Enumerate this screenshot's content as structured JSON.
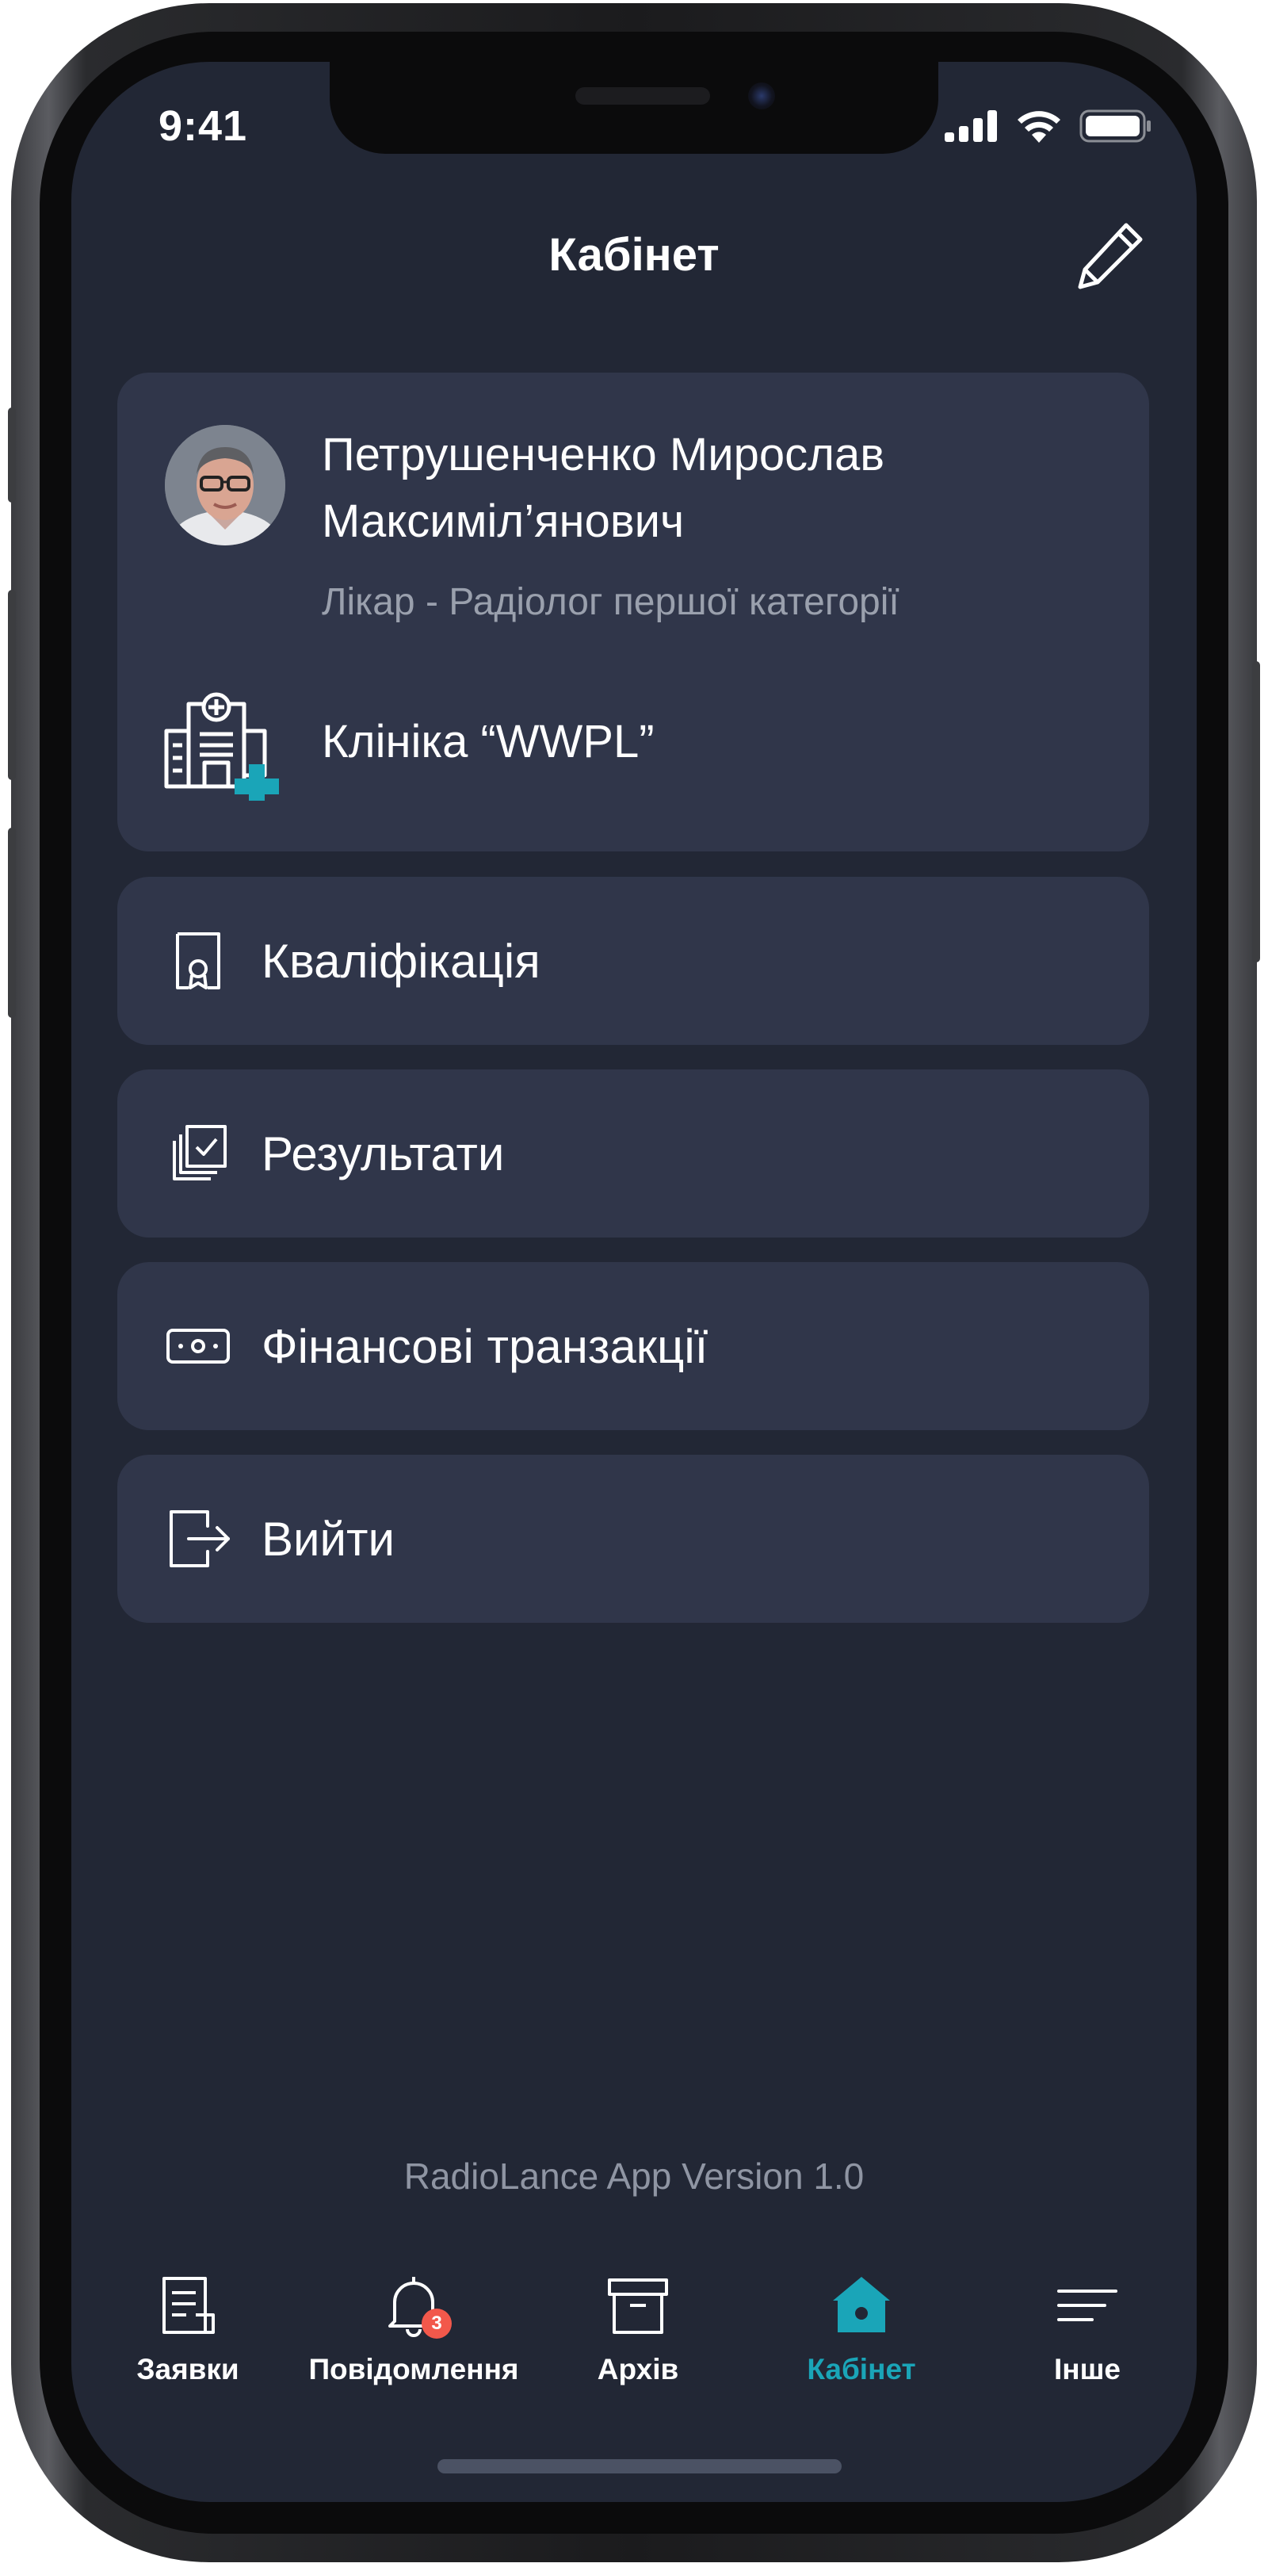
{
  "status_bar": {
    "time": "9:41"
  },
  "header": {
    "title": "Кабінет"
  },
  "profile": {
    "name": "Петрушенченко Мирослав Максиміл’янович",
    "role": "Лікар - Радіолог першої категорії",
    "clinic": "Клініка “WWPL”"
  },
  "menu": [
    {
      "label": "Кваліфікація",
      "icon": "certificate-icon"
    },
    {
      "label": "Результати",
      "icon": "checklist-icon"
    },
    {
      "label": "Фінансові транзакції",
      "icon": "money-icon"
    },
    {
      "label": "Вийти",
      "icon": "logout-icon"
    }
  ],
  "version": "RadioLance App Version 1.0",
  "tabbar": {
    "items": [
      {
        "label": "Заявки",
        "icon": "document-icon"
      },
      {
        "label": "Повідомлення",
        "icon": "bell-icon",
        "badge": "3"
      },
      {
        "label": "Архів",
        "icon": "archive-icon"
      },
      {
        "label": "Кабінет",
        "icon": "home-icon",
        "active": true
      },
      {
        "label": "Інше",
        "icon": "menu-icon"
      }
    ]
  },
  "colors": {
    "background": "#222735",
    "card": "#30364a",
    "accent": "#1aa5b8",
    "badge": "#f2584b",
    "secondary_text": "#9aa0ad"
  }
}
